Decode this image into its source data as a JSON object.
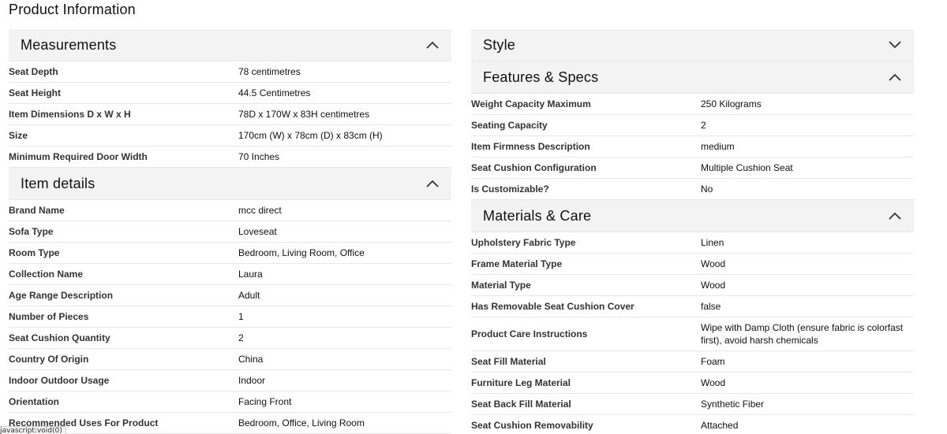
{
  "page_title": "Product Information",
  "left_sections": [
    {
      "title": "Measurements",
      "expanded": true,
      "rows": [
        {
          "label": "Seat Depth",
          "value": "78 centimetres"
        },
        {
          "label": "Seat Height",
          "value": "44.5 Centimetres"
        },
        {
          "label": "Item Dimensions D x W x H",
          "value": "78D x 170W x 83H centimetres"
        },
        {
          "label": "Size",
          "value": "170cm (W) x 78cm (D) x 83cm (H)"
        },
        {
          "label": "Minimum Required Door Width",
          "value": "70 Inches"
        }
      ]
    },
    {
      "title": "Item details",
      "expanded": true,
      "rows": [
        {
          "label": "Brand Name",
          "value": "mcc direct"
        },
        {
          "label": "Sofa Type",
          "value": "Loveseat"
        },
        {
          "label": "Room Type",
          "value": "Bedroom, Living Room, Office"
        },
        {
          "label": "Collection Name",
          "value": "Laura"
        },
        {
          "label": "Age Range Description",
          "value": "Adult"
        },
        {
          "label": "Number of Pieces",
          "value": "1"
        },
        {
          "label": "Seat Cushion Quantity",
          "value": "2"
        },
        {
          "label": "Country Of Origin",
          "value": "China"
        },
        {
          "label": "Indoor Outdoor Usage",
          "value": "Indoor"
        },
        {
          "label": "Orientation",
          "value": "Facing Front"
        },
        {
          "label": "Recommended Uses For Product",
          "value": "Bedroom, Office, Living Room"
        }
      ]
    }
  ],
  "right_sections": [
    {
      "title": "Style",
      "expanded": false,
      "rows": []
    },
    {
      "title": "Features & Specs",
      "expanded": true,
      "rows": [
        {
          "label": "Weight Capacity Maximum",
          "value": "250 Kilograms"
        },
        {
          "label": "Seating Capacity",
          "value": "2"
        },
        {
          "label": "Item Firmness Description",
          "value": "medium"
        },
        {
          "label": "Seat Cushion Configuration",
          "value": "Multiple Cushion Seat"
        },
        {
          "label": "Is Customizable?",
          "value": "No"
        }
      ]
    },
    {
      "title": "Materials & Care",
      "expanded": true,
      "rows": [
        {
          "label": "Upholstery Fabric Type",
          "value": "Linen"
        },
        {
          "label": "Frame Material Type",
          "value": "Wood"
        },
        {
          "label": "Material Type",
          "value": "Wood"
        },
        {
          "label": "Has Removable Seat Cushion Cover",
          "value": "false"
        },
        {
          "label": "Product Care Instructions",
          "value": "Wipe with Damp Cloth (ensure fabric is colorfast first), avoid harsh chemicals"
        },
        {
          "label": "Seat Fill Material",
          "value": "Foam"
        },
        {
          "label": "Furniture Leg Material",
          "value": "Wood"
        },
        {
          "label": "Seat Back Fill Material",
          "value": "Synthetic Fiber"
        },
        {
          "label": "Seat Cushion Removability",
          "value": "Attached"
        }
      ]
    }
  ],
  "status_tooltip": "javascript:void(0)",
  "icons": {
    "expanded": "chevron-up-icon",
    "collapsed": "chevron-down-icon"
  }
}
